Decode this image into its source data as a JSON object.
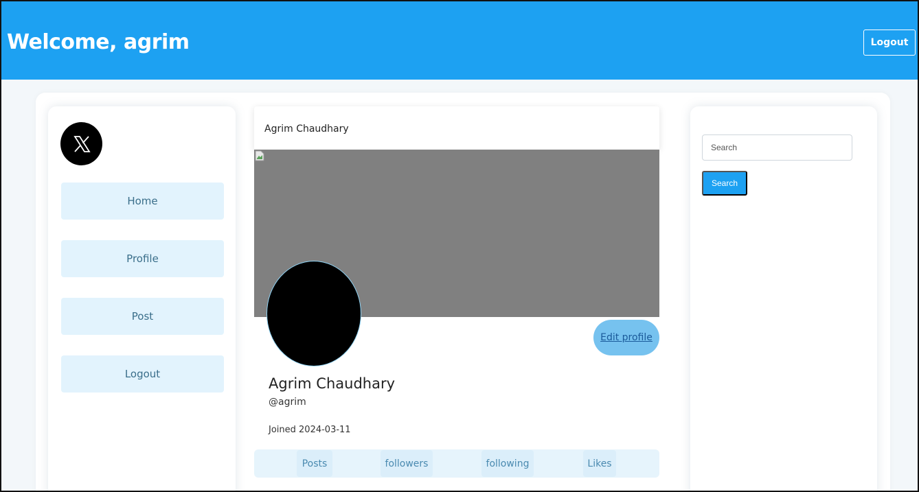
{
  "header": {
    "welcome": "Welcome, agrim",
    "logout_label": "Logout"
  },
  "sidebar": {
    "logo_icon": "x-logo-icon",
    "items": [
      {
        "label": "Home"
      },
      {
        "label": "Profile"
      },
      {
        "label": "Post"
      },
      {
        "label": "Logout"
      }
    ]
  },
  "profile": {
    "header_name": "Agrim Chaudhary",
    "edit_label": "Edit profile",
    "name": "Agrim Chaudhary",
    "handle": "@agrim",
    "joined": "Joined 2024-03-11",
    "tabs": [
      {
        "label": "Posts"
      },
      {
        "label": "followers"
      },
      {
        "label": "following"
      },
      {
        "label": "Likes"
      }
    ]
  },
  "search": {
    "placeholder": "Search",
    "button_label": "Search"
  },
  "colors": {
    "primary": "#1da1f2",
    "nav_bg": "#e2f3fd",
    "banner": "#808080",
    "edit_btn": "#76c2ef"
  }
}
